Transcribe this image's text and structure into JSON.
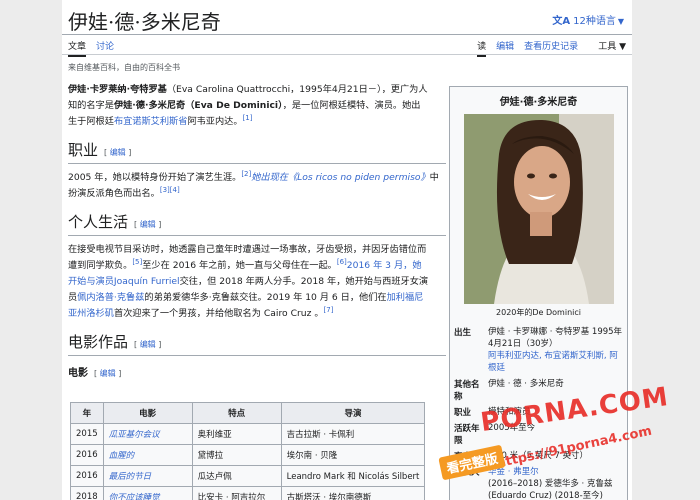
{
  "article": {
    "title": "伊娃·德·多米尼奇",
    "languages_label": "12种语言",
    "site_sub": "来自维基百科，自由的百科全书"
  },
  "tabs": {
    "left": [
      "文章",
      "讨论"
    ],
    "right": [
      "读",
      "编辑",
      "查看历史记录",
      "工具"
    ]
  },
  "lead": {
    "name_cn": "伊娃·卡罗莱纳·夸特罗基",
    "name_orig": "（Eva Carolina Quattrocchi，1995年4月21日－），更广为人",
    "line2_a": "知的名字是",
    "stage_name": "伊娃·德·多米尼奇（Eva De Dominici）",
    "line2_b": "，是一位阿根廷模特、演员。她出",
    "line3_a": "生于阿根廷",
    "province_link": "布宜诺斯艾利斯省",
    "line3_b": "阿韦亚内达。",
    "ref": "[1]"
  },
  "sections": {
    "career": {
      "heading": "职业",
      "edit": "编辑",
      "text_a": "2005 年，她以模特身份开始了演艺生涯。",
      "ref_a": "[2]",
      "link": "她出现在《Los ricos no piden permiso》",
      "text_b": "中",
      "text_c": "扮演反派角色而出名。",
      "ref_b": "[3][4]"
    },
    "personal": {
      "heading": "个人生活",
      "edit": "编辑",
      "line1": "在接受电视节目采访时，她透露自己童年时遭遇过一场事故，牙齿受损，并因牙齿错位而",
      "line2_a": "遭到同学欺负。",
      "ref1": "[5]",
      "line2_b": "至少在 2016 年之前，她一直与父母住在一起。",
      "ref2": "[6]",
      "link1": "2016 年 3 月，她",
      "link1b": "开始与演员Joaquín Furriel",
      "line3": "交往，但 2018 年两人分手。2018 年，她开始与西班牙女演",
      "line4_a": "员",
      "link2": "佩内洛普·克鲁兹",
      "line4_b": "的弟弟爱德华多·克鲁兹交往。2019 年 10 月 6 日，他们在",
      "link3": "加利福尼",
      "link3b": "亚州洛杉矶",
      "line5": "首次迎来了一个男孩，并给他取名为 Cairo Cruz 。",
      "ref3": "[7]"
    },
    "works": {
      "heading": "电影作品",
      "edit": "编辑"
    },
    "film": {
      "heading": "电影",
      "edit": "编辑"
    }
  },
  "films_table": {
    "headers": [
      "年",
      "电影",
      "特点",
      "导演"
    ],
    "rows": [
      [
        "2015",
        "瓜亚基尔会议",
        "奥利维亚",
        "吉古拉斯 · 卡佩利"
      ],
      [
        "2016",
        "血腥的",
        "黛博拉",
        "埃尔南 · 贝隆"
      ],
      [
        "2016",
        "最后的节日",
        "瓜达卢佩",
        "Leandro Mark 和 Nicolás Silbert"
      ],
      [
        "2018",
        "你不应该睡觉",
        "比安卡 · 阿吉拉尔",
        "古斯塔沃 · 埃尔南德斯"
      ]
    ]
  },
  "infobox": {
    "title": "伊娃·德·多米尼奇",
    "caption": "2020年的De Dominici",
    "rows": [
      {
        "label": "出生",
        "value": "伊娃 · 卡罗琳娜 · 夸特罗基 1995年4月21日（30岁）",
        "link": "阿韦利亚内达, 布宜诺斯艾利斯, 阿根廷"
      },
      {
        "label": "其他名称",
        "value": "伊娃 · 德 · 多米尼奇",
        "link": ""
      },
      {
        "label": "职业",
        "value": "模特和演员",
        "link": ""
      },
      {
        "label": "活跃年限",
        "value": "2005年至今",
        "link": ""
      },
      {
        "label": "高度",
        "value": "1.70 米（5 英尺 7 英寸）",
        "link": ""
      },
      {
        "label": "合伙人",
        "value": "(2016–2018) 爱德华多 · 克鲁兹 (Eduardo Cruz) (2018-至今)",
        "link": "华金 · 弗里尔"
      }
    ]
  },
  "watermark": {
    "logo": "PORNA.COM",
    "badge": "看完整版",
    "url": "https://91porna4.com"
  },
  "colors": {
    "link": "#3366cc",
    "watermark_red": "#e8302a",
    "watermark_orange": "#f59a23"
  }
}
